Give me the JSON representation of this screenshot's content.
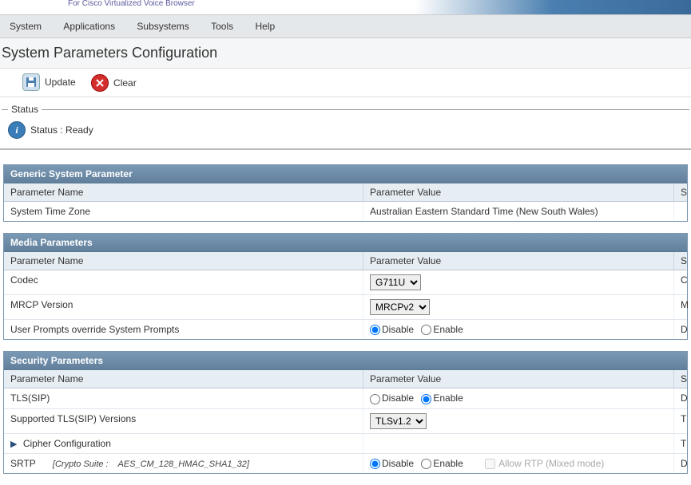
{
  "product_subtitle": "For Cisco Virtualized Voice Browser",
  "menu": [
    "System",
    "Applications",
    "Subsystems",
    "Tools",
    "Help"
  ],
  "page_title": "System Parameters Configuration",
  "toolbar": {
    "update_label": "Update",
    "clear_label": "Clear"
  },
  "status": {
    "legend": "Status",
    "text": "Status : Ready"
  },
  "columns": {
    "name": "Parameter Name",
    "value": "Parameter Value",
    "s": "S"
  },
  "panels": {
    "generic": {
      "title": "Generic System Parameter",
      "rows": [
        {
          "name": "System Time Zone",
          "value": "Australian Eastern Standard Time (New South Wales)"
        }
      ]
    },
    "media": {
      "title": "Media Parameters",
      "codec_label": "Codec",
      "codec_value": "G711U",
      "mrcp_label": "MRCP Version",
      "mrcp_value": "MRCPv2",
      "prompts_label": "User Prompts override System Prompts",
      "disable_label": "Disable",
      "enable_label": "Enable",
      "prompts_value": "disable",
      "s_codec": "C",
      "s_mrcp": "M",
      "s_prompts": "D"
    },
    "security": {
      "title": "Security Parameters",
      "tls_label": "TLS(SIP)",
      "tls_value": "enable",
      "supported_tls_label": "Supported TLS(SIP) Versions",
      "supported_tls_value": "TLSv1.2",
      "cipher_label": "Cipher Configuration",
      "srtp_label": "SRTP",
      "srtp_crypto_prefix": "[Crypto Suite :",
      "srtp_crypto_value": "AES_CM_128_HMAC_SHA1_32]",
      "srtp_value": "disable",
      "allow_rtp_label": "Allow RTP (Mixed mode)",
      "disable_label": "Disable",
      "enable_label": "Enable",
      "s_tls": "D",
      "s_supported": "T",
      "s_cipher": "T",
      "s_srtp": "D"
    }
  }
}
